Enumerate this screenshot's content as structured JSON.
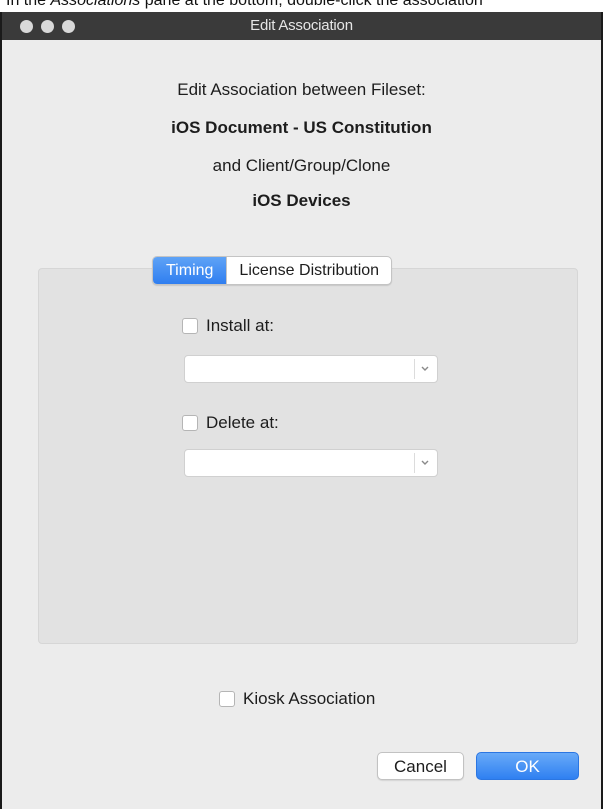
{
  "caption": {
    "prefix": "In the ",
    "italic": "Associations",
    "suffix": " pane at the bottom, double-click the association"
  },
  "window": {
    "title": "Edit Association"
  },
  "header": {
    "line1": "Edit Association between Fileset:",
    "fileset_name": "iOS Document - US Constitution",
    "line3": "and Client/Group/Clone",
    "target_name": "iOS Devices"
  },
  "tabs": [
    {
      "label": "Timing",
      "active": true
    },
    {
      "label": "License Distribution",
      "active": false
    }
  ],
  "timing": {
    "install_label": "Install at:",
    "install_checked": false,
    "install_value": "",
    "delete_label": "Delete at:",
    "delete_checked": false,
    "delete_value": ""
  },
  "kiosk": {
    "label": "Kiosk Association",
    "checked": false
  },
  "buttons": {
    "cancel": "Cancel",
    "ok": "OK"
  },
  "colors": {
    "accent": "#2f7ef0",
    "titlebar": "#3a3a3a",
    "window_bg": "#ececec"
  }
}
